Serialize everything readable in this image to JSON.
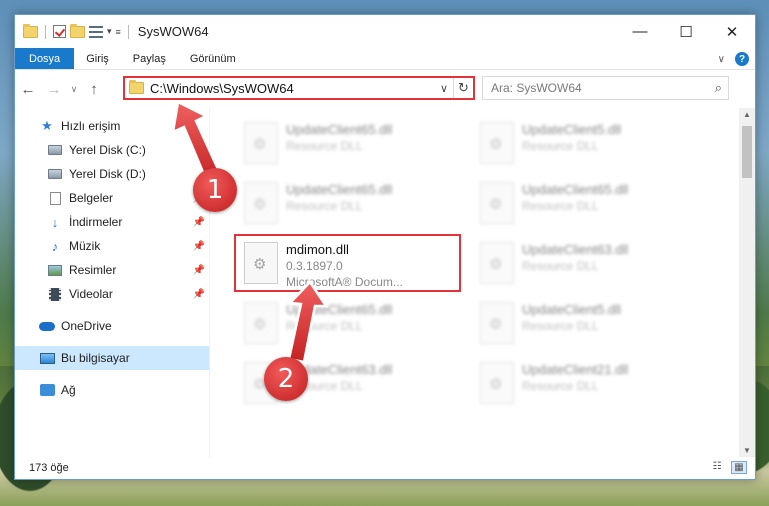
{
  "window": {
    "title": "SysWOW64",
    "minimize": "—",
    "maximize": "☐",
    "close": "✕"
  },
  "ribbon": {
    "tabs": [
      {
        "label": "Dosya",
        "active": true
      },
      {
        "label": "Giriş"
      },
      {
        "label": "Paylaş"
      },
      {
        "label": "Görünüm"
      }
    ],
    "help": "?"
  },
  "address": {
    "path": "C:\\Windows\\SysWOW64",
    "search_placeholder": "Ara: SysWOW64"
  },
  "nav": {
    "items": [
      {
        "label": "Hızlı erişim",
        "icon": "star-icon"
      },
      {
        "label": "Yerel Disk (C:)",
        "icon": "disk-icon"
      },
      {
        "label": "Yerel Disk (D:)",
        "icon": "disk-icon"
      },
      {
        "label": "Belgeler",
        "icon": "documents-icon"
      },
      {
        "label": "İndirmeler",
        "icon": "downloads-icon"
      },
      {
        "label": "Müzik",
        "icon": "music-icon"
      },
      {
        "label": "Resimler",
        "icon": "pictures-icon"
      },
      {
        "label": "Videolar",
        "icon": "videos-icon"
      },
      {
        "label": "OneDrive",
        "icon": "onedrive-icon"
      },
      {
        "label": "Bu bilgisayar",
        "icon": "this-pc-icon"
      },
      {
        "label": "Ağ",
        "icon": "network-icon"
      }
    ]
  },
  "files": {
    "focused": {
      "name": "mdimon.dll",
      "version": "0.3.1897.0",
      "description": "MicrosoftA® Docum..."
    },
    "blurred": [
      {
        "name": "UpdateClient65.dll",
        "sub": "Resource DLL"
      },
      {
        "name": "UpdateClient5.dll",
        "sub": "Resource DLL"
      },
      {
        "name": "UpdateClient65.dll",
        "sub": "Resource DLL"
      },
      {
        "name": "UpdateClient65.dll",
        "sub": "Resource DLL"
      },
      {
        "name": "UpdateClient63.dll",
        "sub": "Resource DLL"
      },
      {
        "name": "UpdateClient65.dll",
        "sub": "Resource DLL"
      },
      {
        "name": "UpdateClient5.dll",
        "sub": "Resource DLL"
      },
      {
        "name": "UpdateClient63.dll",
        "sub": "Resource DLL"
      },
      {
        "name": "UpdateClient21.dll",
        "sub": "Resource DLL"
      }
    ]
  },
  "status": {
    "count": "173 öğe"
  },
  "callouts": {
    "one": "1",
    "two": "2"
  },
  "colors": {
    "accent": "#1979ca",
    "highlight": "#e3323a",
    "selected": "#cce8ff"
  }
}
